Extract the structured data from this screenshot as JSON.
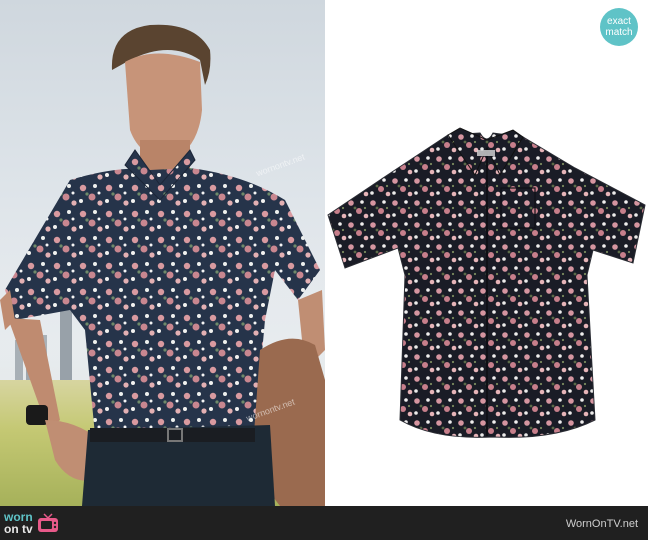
{
  "badge": {
    "line1": "exact",
    "line2": "match"
  },
  "footer": {
    "logo_line1": "worn",
    "logo_line2": "on tv",
    "site": "WornOnTV.net"
  },
  "watermark": "wornontv.net",
  "icons": [
    "tv-icon"
  ],
  "colors": {
    "accent": "#5fc3c7",
    "footer_bg": "#202020",
    "shirt_dark": "#1e2330",
    "flower_pink": "#d99aa0"
  }
}
